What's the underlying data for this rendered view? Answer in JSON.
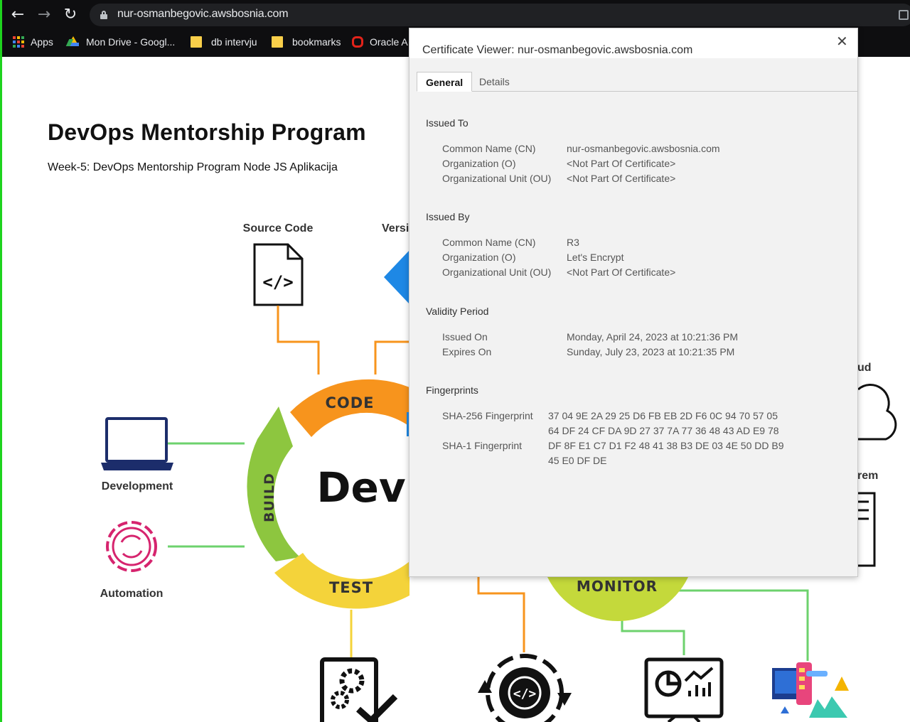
{
  "browser": {
    "url": "nur-osmanbegovic.awsbosnia.com",
    "bookmarks": [
      {
        "label": "Apps",
        "icon": "apps-grid-icon"
      },
      {
        "label": "Mon Drive - Googl...",
        "icon": "google-drive-icon"
      },
      {
        "label": "db intervju",
        "icon": "folder-icon"
      },
      {
        "label": "bookmarks",
        "icon": "folder-icon"
      },
      {
        "label": "Oracle A",
        "icon": "oracle-icon"
      }
    ]
  },
  "page": {
    "title": "DevOps Mentorship Program",
    "subtitle": "Week-5: DevOps Mentorship Program Node JS Aplikacija",
    "diagram": {
      "source_code_label": "Source Code",
      "version_label_partial": "Versi",
      "cloud_label_partial": "ud",
      "container_label_partial": "rem",
      "development_label": "Development",
      "automation_label": "Automation",
      "center_text": "Dev",
      "ring_labels": {
        "code": "CODE",
        "build": "BUILD",
        "test": "TEST",
        "monitor": "MONITOR"
      },
      "colors": {
        "orange": "#f7941d",
        "green": "#8dc63f",
        "yellow": "#f4d33a",
        "lime": "#c4d93b",
        "navy": "#1c2d6b",
        "magenta": "#d6246e",
        "line_green": "#6dd26d",
        "line_orange": "#f7941d",
        "blue": "#1e88e5"
      }
    }
  },
  "certificate": {
    "title": "Certificate Viewer: nur-osmanbegovic.awsbosnia.com",
    "tabs": [
      "General",
      "Details"
    ],
    "active_tab": "General",
    "issued_to": {
      "heading": "Issued To",
      "rows": [
        {
          "label": "Common Name (CN)",
          "value": "nur-osmanbegovic.awsbosnia.com"
        },
        {
          "label": "Organization (O)",
          "value": "<Not Part Of Certificate>"
        },
        {
          "label": "Organizational Unit (OU)",
          "value": "<Not Part Of Certificate>"
        }
      ]
    },
    "issued_by": {
      "heading": "Issued By",
      "rows": [
        {
          "label": "Common Name (CN)",
          "value": "R3"
        },
        {
          "label": "Organization (O)",
          "value": "Let's Encrypt"
        },
        {
          "label": "Organizational Unit (OU)",
          "value": "<Not Part Of Certificate>"
        }
      ]
    },
    "validity": {
      "heading": "Validity Period",
      "rows": [
        {
          "label": "Issued On",
          "value": "Monday, April 24, 2023 at 10:21:36 PM"
        },
        {
          "label": "Expires On",
          "value": "Sunday, July 23, 2023 at 10:21:35 PM"
        }
      ]
    },
    "fingerprints": {
      "heading": "Fingerprints",
      "sha256_label": "SHA-256 Fingerprint",
      "sha256_line1": "37 04 9E 2A 29 25 D6 FB EB 2D F6 0C 94 70 57 05",
      "sha256_line2": "64 DF 24 CF DA 9D 27 37 7A 77 36 48 43 AD E9 78",
      "sha1_label": "SHA-1 Fingerprint",
      "sha1_line1": "DF 8F E1 C7 D1 F2 48 41 38 B3 DE 03 4E 50 DD B9",
      "sha1_line2": "45 E0 DF DE"
    }
  }
}
